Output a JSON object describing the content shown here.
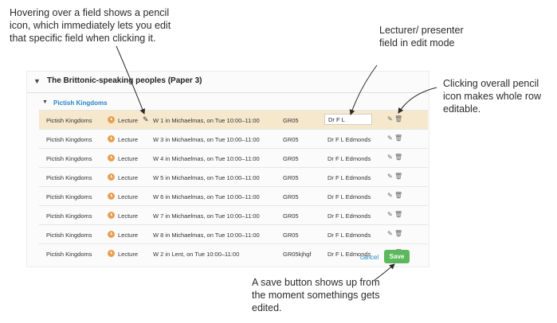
{
  "annotations": {
    "hover_note": "Hovering over a field shows a pencil icon, which immediately lets you edit that specific field when clicking it.",
    "lecturer_note": "Lecturer/ presenter field in edit mode",
    "row_note": "Clicking overall pencil icon makes whole row editable.",
    "save_note": "A save button shows up from the moment somethings gets edited."
  },
  "panel": {
    "title": "The Brittonic-speaking peoples (Paper 3)",
    "sub_title": "Pictish Kingdoms",
    "chevron_icon": "chevron-down-icon"
  },
  "rows": [
    {
      "name": "Pictish Kingdoms",
      "type": "Lecture",
      "time": "W 1 in Michaelmas, on Tue 10:00–11:00",
      "room": "GR05",
      "lecturer": "Dr F L",
      "editing": true
    },
    {
      "name": "Pictish Kingdoms",
      "type": "Lecture",
      "time": "W 3 in Michaelmas, on Tue 10:00–11:00",
      "room": "GR05",
      "lecturer": "Dr F L Edmonds"
    },
    {
      "name": "Pictish Kingdoms",
      "type": "Lecture",
      "time": "W 4 in Michaelmas, on Tue 10:00–11:00",
      "room": "GR05",
      "lecturer": "Dr F L Edmonds"
    },
    {
      "name": "Pictish Kingdoms",
      "type": "Lecture",
      "time": "W 5 in Michaelmas, on Tue 10:00–11:00",
      "room": "GR05",
      "lecturer": "Dr F L Edmonds"
    },
    {
      "name": "Pictish Kingdoms",
      "type": "Lecture",
      "time": "W 6 in Michaelmas, on Tue 10:00–11:00",
      "room": "GR05",
      "lecturer": "Dr F L Edmonds"
    },
    {
      "name": "Pictish Kingdoms",
      "type": "Lecture",
      "time": "W 7 in Michaelmas, on Tue 10:00–11:00",
      "room": "GR05",
      "lecturer": "Dr F L Edmonds"
    },
    {
      "name": "Pictish Kingdoms",
      "type": "Lecture",
      "time": "W 8 in Michaelmas, on Tue 10:00–11:00",
      "room": "GR05",
      "lecturer": "Dr F L Edmonds"
    },
    {
      "name": "Pictish Kingdoms",
      "type": "Lecture",
      "time": "W 2 in Lent, on Tue 10:00–11:00",
      "room": "GR05kjhgf",
      "lecturer": "Dr F L Edmonds"
    }
  ],
  "icons": {
    "type_icon": "clock-icon",
    "field_edit_icon": "pencil-icon",
    "row_edit_icon": "pencil-icon",
    "row_delete_icon": "trash-icon"
  },
  "actions": {
    "cancel_label": "cancel",
    "save_label": "Save"
  },
  "colors": {
    "editing_row_bg": "#f6e8cd",
    "link_blue": "#2a85c9",
    "save_green": "#5cb85c",
    "clock_orange": "#e8a052"
  }
}
